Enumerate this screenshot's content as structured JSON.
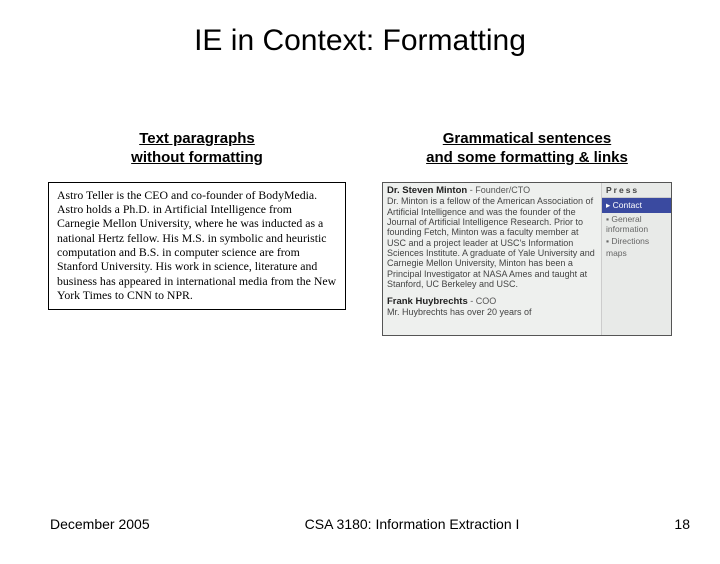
{
  "title": "IE in Context: Formatting",
  "left": {
    "heading": "Text paragraphs\nwithout formatting",
    "body": "Astro Teller is the CEO and co-founder of BodyMedia. Astro holds a Ph.D. in Artificial Intelligence from Carnegie Mellon University, where he was inducted as a national Hertz fellow. His M.S. in symbolic and heuristic computation and B.S. in computer science are from Stanford University. His work in science, literature and business has appeared in international media from the New York Times to CNN to NPR."
  },
  "right": {
    "heading": "Grammatical sentences\nand some formatting & links",
    "name1": "Dr. Steven Minton",
    "role1": "Founder/CTO",
    "para1": "Dr. Minton is a fellow of the American Association of Artificial Intelligence and was the founder of the Journal of Artificial Intelligence Research. Prior to founding Fetch, Minton was a faculty member at USC and a project leader at USC's Information Sciences Institute. A graduate of Yale University and Carnegie Mellon University, Minton has been a Principal Investigator at NASA Ames and taught at Stanford, UC Berkeley and USC.",
    "name2": "Frank Huybrechts",
    "role2": "COO",
    "para2": "Mr. Huybrechts has over 20 years of",
    "side_head": "Press",
    "side_active": "Contact",
    "side_link1": "General information",
    "side_link2": "Directions",
    "side_link3": "maps"
  },
  "footer": {
    "date": "December 2005",
    "course": "CSA 3180: Information Extraction I",
    "page": "18"
  }
}
